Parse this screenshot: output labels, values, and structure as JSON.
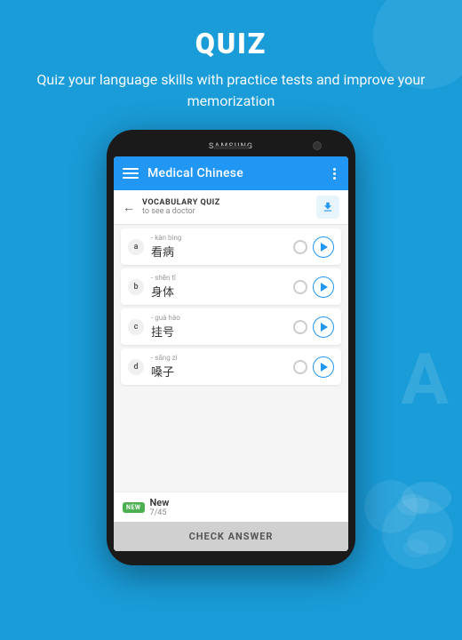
{
  "page": {
    "background_color": "#1a9cd8"
  },
  "header": {
    "quiz_title": "QUIZ",
    "subtitle": "Quiz your language skills with practice tests and improve your memorization"
  },
  "app": {
    "brand": "SAMSUNG",
    "toolbar": {
      "title": "Medical Chinese",
      "menu_icon": "hamburger-menu-icon",
      "more_icon": "more-vert-icon"
    },
    "vocab_bar": {
      "label": "VOCABULARY QUIZ",
      "subtitle": "to see a doctor",
      "download_icon": "download-icon"
    },
    "options": [
      {
        "letter": "a",
        "pinyin": "- kàn bìng",
        "chinese": "看病"
      },
      {
        "letter": "b",
        "pinyin": "- shēn tǐ",
        "chinese": "身体"
      },
      {
        "letter": "c",
        "pinyin": "- guà hào",
        "chinese": "挂号"
      },
      {
        "letter": "d",
        "pinyin": "- sǎng zi",
        "chinese": "嗓子"
      }
    ],
    "new_badge": "NEW",
    "new_word": "New",
    "progress": "7/45",
    "check_answer_btn": "CHECK ANSWER"
  }
}
